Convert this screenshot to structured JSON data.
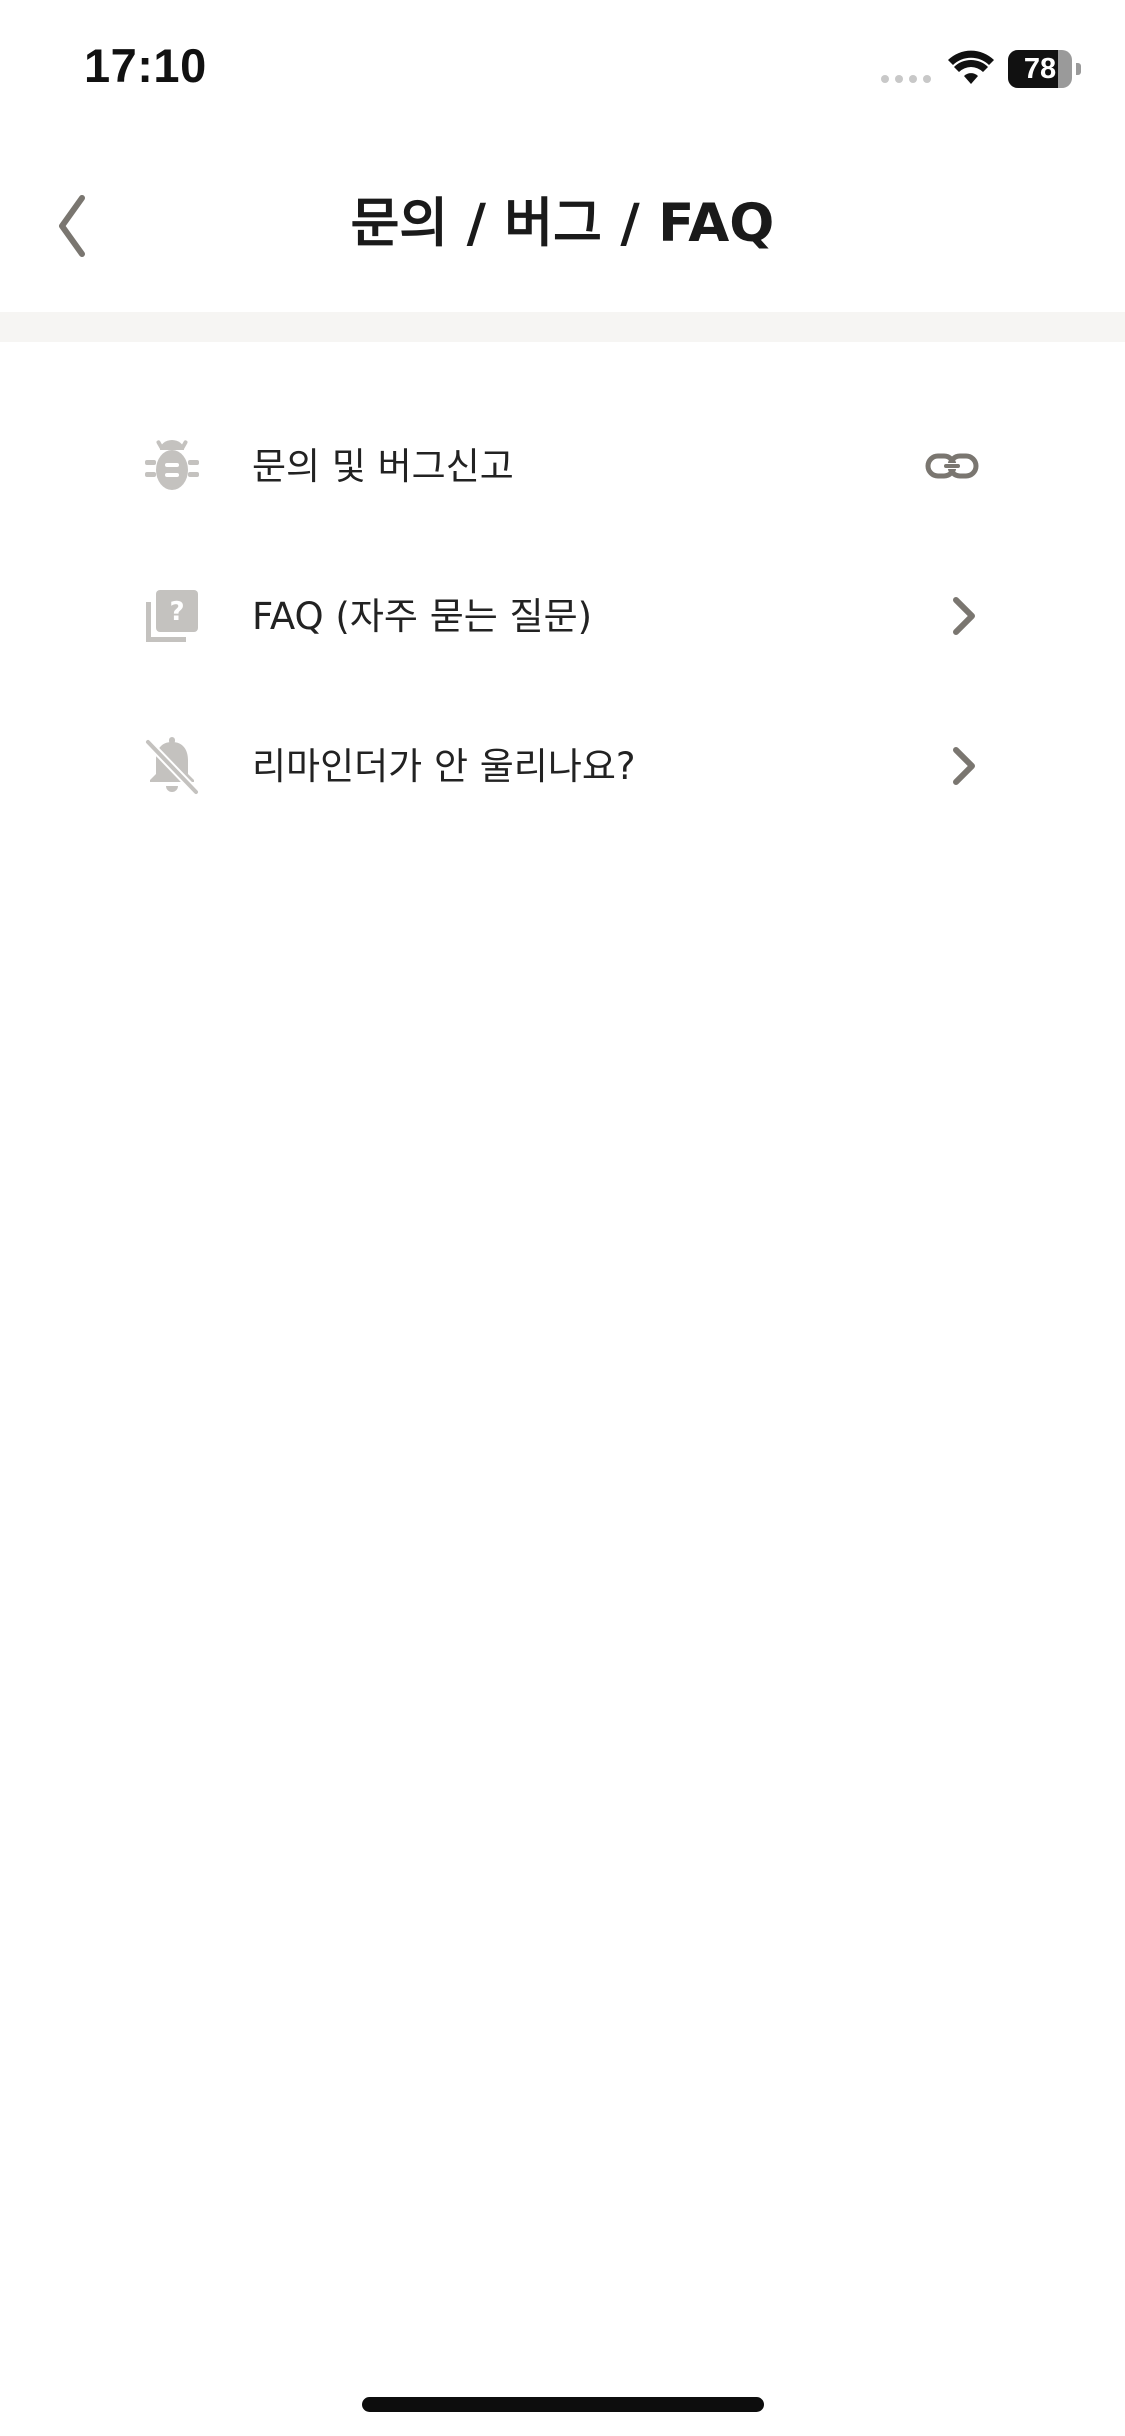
{
  "status_bar": {
    "time": "17:10",
    "battery_level": "78"
  },
  "nav": {
    "title": "문의 / 버그 / FAQ",
    "back_icon": "chevron-left-icon"
  },
  "menu": {
    "items": [
      {
        "label": "문의 및 버그신고",
        "icon": "bug-icon",
        "trailing_icon": "link-icon"
      },
      {
        "label": "FAQ (자주 묻는 질문)",
        "icon": "question-book-icon",
        "trailing_icon": "chevron-right-icon"
      },
      {
        "label": "리마인더가 안 울리나요?",
        "icon": "bell-off-icon",
        "trailing_icon": "chevron-right-icon"
      }
    ]
  },
  "colors": {
    "icon_gray": "#c4c2bf",
    "trailing_gray": "#7a7670",
    "back_gray": "#7a7670",
    "text": "#222222",
    "band": "#f6f5f3"
  }
}
